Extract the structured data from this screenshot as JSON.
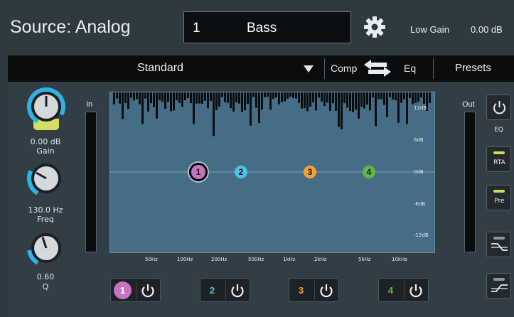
{
  "header": {
    "source_label": "Source: Analog",
    "channel_number": "1",
    "channel_name": "Bass",
    "low_gain_label": "Low Gain",
    "low_gain_value": "0.00 dB"
  },
  "toolbar": {
    "preset_name": "Standard",
    "comp_label": "Comp",
    "eq_label": "Eq",
    "presets_label": "Presets"
  },
  "knobs": {
    "gain": {
      "value": "0.00 dB",
      "label": "Gain"
    },
    "freq": {
      "value": "130.0 Hz",
      "label": "Freq"
    },
    "q": {
      "value": "0.60",
      "label": "Q"
    }
  },
  "meters": {
    "in_label": "In",
    "out_label": "Out"
  },
  "graph": {
    "db_labels": [
      "12dB",
      "6dB",
      "0dB",
      "-6dB",
      "-12dB"
    ],
    "freq_labels": [
      "50Hz",
      "100Hz",
      "200Hz",
      "500Hz",
      "1kHz",
      "2kHz",
      "5kHz",
      "10kHz"
    ],
    "bands": [
      {
        "num": "1",
        "color": "#c772c2",
        "selected": true
      },
      {
        "num": "2",
        "color": "#4dc3ea"
      },
      {
        "num": "3",
        "color": "#f0a232"
      },
      {
        "num": "4",
        "color": "#5cb848"
      }
    ]
  },
  "band_buttons": [
    {
      "num": "1",
      "color": "#c772c2",
      "text_color": "#ffffff"
    },
    {
      "num": "2",
      "color": "#1d2226",
      "text_color": "#4dc3ea"
    },
    {
      "num": "3",
      "color": "#1d2226",
      "text_color": "#f0a232"
    },
    {
      "num": "4",
      "color": "#1d2226",
      "text_color": "#5cb848"
    }
  ],
  "side_buttons": {
    "eq": "EQ",
    "rta": "RTA",
    "pre": "Pre"
  },
  "colors": {
    "accent_blue": "#2fb3e3",
    "led_green": "#c8e05a",
    "gain_tab": "#d4de63"
  }
}
